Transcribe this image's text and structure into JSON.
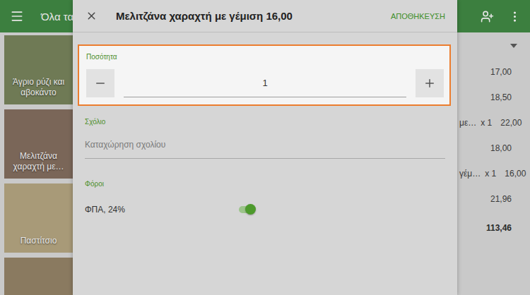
{
  "app_bar": {
    "title": "Όλα τα"
  },
  "products": [
    {
      "name": "Άγριο ρύζι και αβοκάντο",
      "color": "#6f7a55"
    },
    {
      "name": "Μελιτζάνα χαραχτή με…",
      "color": "#7a6658"
    },
    {
      "name": "Παστίτσιο",
      "color": "#a89a78"
    },
    {
      "name": "",
      "color": "#8a7a60"
    }
  ],
  "order": {
    "rows": [
      {
        "name": "",
        "quantity": "",
        "price": "17,00"
      },
      {
        "name": "",
        "quantity": "",
        "price": "18,50"
      },
      {
        "name": "με…",
        "quantity": "x 1",
        "price": "22,00"
      },
      {
        "name": "",
        "quantity": "",
        "price": "18,00"
      },
      {
        "name": "γέμ…",
        "quantity": "x 1",
        "price": "16,00"
      },
      {
        "name": "",
        "quantity": "",
        "price": "21,96"
      }
    ],
    "total": "113,46"
  },
  "dialog": {
    "title": "Μελιτζάνα χαραχτή με γέμιση 16,00",
    "save": "ΑΠΟΘΗΚΕΥΣΗ",
    "quantity": {
      "label": "Ποσότητα",
      "value": "1",
      "highlighted": true
    },
    "comment": {
      "label": "Σχόλιο",
      "placeholder": "Καταχώρηση σχολίου"
    },
    "taxes": {
      "label": "Φόροι",
      "items": [
        {
          "name": "ΦΠΑ, 24%",
          "on": true
        }
      ]
    }
  }
}
